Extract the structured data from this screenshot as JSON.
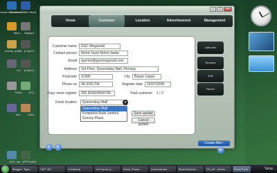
{
  "desktop": {
    "icons": [
      {
        "label": "Celcom Broadband",
        "color": "#2d6fb5"
      },
      {
        "label": "Microsoft Office Word",
        "color": "#2f5ea8"
      },
      {
        "label": "Mom...",
        "color": "#d99a2a"
      },
      {
        "label": "MyAppl...",
        "color": "#777"
      },
      {
        "label": "money_arabic",
        "color": "#c9a24a"
      },
      {
        "label": "[Cipe02...",
        "color": "#555"
      },
      {
        "label": "rel...",
        "color": "#667"
      },
      {
        "label": "[Cipe02...",
        "color": "#555"
      },
      {
        "label": "Ticker",
        "color": "#999"
      },
      {
        "label": "(12)...",
        "color": "#7a7"
      },
      {
        "label": "dev...",
        "color": "#669"
      },
      {
        "label": "Ubia...",
        "color": "#b85"
      },
      {
        "label": "IAM_Lay...",
        "color": "#58a"
      },
      {
        "label": "WRTtoolkit",
        "color": "#464"
      }
    ]
  },
  "app": {
    "nav_tabs": [
      "Home",
      "Customer",
      "Location",
      "Advertisement",
      "Management"
    ],
    "active_tab": 1,
    "form": {
      "customer_name": {
        "label": "Customer name",
        "value": "GSC Megamall"
      },
      "contact_person": {
        "label": "Contact person",
        "value": "Mohd Yazid Mohd Jaafar"
      },
      "email": {
        "label": "Email",
        "value": "queries@gscmegamall.com"
      },
      "address": {
        "label": "Address",
        "value": "3rd Floor, Queensbay Mall, Penang"
      },
      "postcode": {
        "label": "Postcode",
        "value": "11900"
      },
      "city": {
        "label": "City",
        "value": "Bayan Lepas"
      },
      "phone": {
        "label": "Phone no",
        "value": "04-3241764"
      },
      "register_date": {
        "label": "Register date",
        "value": "10/07/2008"
      },
      "days_since_register": {
        "label": "Days since register",
        "value": "265.453824566796"
      },
      "total_customer": {
        "label": "Total customer",
        "value": "1 / 2"
      },
      "kiosk_location": {
        "label": "Kiosk location",
        "value": "Queensbay Mall"
      }
    },
    "dropdown_options": [
      "Queensbay Mall",
      "Kompleks Bukit Jambul",
      "Gurney Plaza"
    ],
    "dropdown_selected": 0,
    "buttons": {
      "save_update": "Save update",
      "cancel_update": "Cancel update",
      "add_new": "Add new",
      "remove": "Remove",
      "edit": "Edit",
      "revert": "Revert",
      "create_ads": "Create Ads ›"
    },
    "pager": {
      "prev": "«",
      "next": "»"
    }
  },
  "taskbar": {
    "tasks": [
      "Blogger: Tapa...",
      "CMT 331",
      "Crealtonal",
      "Yod report (c...",
      "Kiosk_Phase...",
      "Administrator...",
      "BhotoNAdmin...",
      "SS.pdf - Adobe...",
      "Kiosk Form"
    ],
    "active_task": 8,
    "clock": "Tamp..."
  }
}
